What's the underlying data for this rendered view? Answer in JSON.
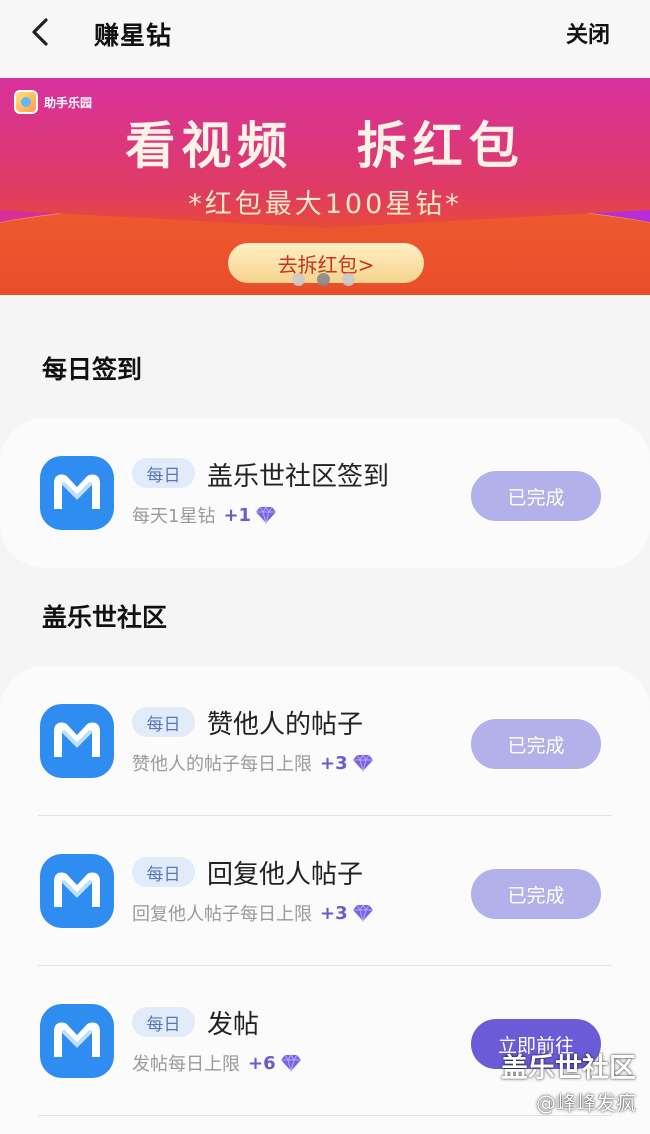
{
  "header": {
    "title": "赚星钻",
    "close_label": "关闭"
  },
  "banner": {
    "app_name": "助手乐园",
    "title": "看视频 拆红包",
    "subtitle": "*红包最大100星钻*",
    "button_label": "去拆红包>",
    "carousel": {
      "count": 3,
      "active_index": 1
    }
  },
  "sections": [
    {
      "title": "每日签到",
      "tasks": [
        {
          "tag": "每日",
          "name": "盖乐世社区签到",
          "desc": "每天1星钻",
          "reward": "+1",
          "button": "已完成",
          "done": true
        }
      ]
    },
    {
      "title": "盖乐世社区",
      "tasks": [
        {
          "tag": "每日",
          "name": "赞他人的帖子",
          "desc": "赞他人的帖子每日上限",
          "reward": "+3",
          "button": "已完成",
          "done": true
        },
        {
          "tag": "每日",
          "name": "回复他人帖子",
          "desc": "回复他人帖子每日上限",
          "reward": "+3",
          "button": "已完成",
          "done": true
        },
        {
          "tag": "每日",
          "name": "发帖",
          "desc": "发帖每日上限",
          "reward": "+6",
          "button": "立即前往",
          "done": false
        }
      ]
    }
  ],
  "watermark": {
    "line1": "盖乐世社区",
    "line2": "@峰峰发疯"
  },
  "colors": {
    "accent": "#6b5bd6",
    "done_button": "#b4b0ea",
    "app_icon": "#2f8cf0",
    "tag_bg": "#e2ebfa"
  },
  "icons": {
    "back": "chevron-left-icon",
    "app": "m-logo-icon",
    "reward": "diamond-icon"
  }
}
